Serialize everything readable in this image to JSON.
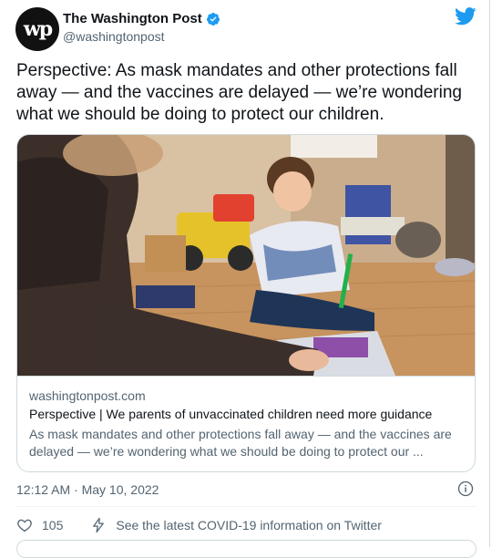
{
  "author": {
    "display_name": "The Washington Post",
    "handle": "@washingtonpost",
    "avatar_text": "wp"
  },
  "tweet": {
    "text": "Perspective: As mask mandates and other protections fall away — and the vaccines are delayed — we’re wondering what we should be doing to protect our children."
  },
  "card": {
    "domain": "washingtonpost.com",
    "title": "Perspective | We parents of unvaccinated children need more guidance",
    "description": "As mask mandates and other protections fall away — and the vaccines are delayed — we’re wondering what we should be doing to protect our ..."
  },
  "meta": {
    "timestamp": "12:12 AM · May 10, 2022"
  },
  "actions": {
    "like_count": "105",
    "covid_link": "See the latest COVID-19 information on Twitter"
  },
  "colors": {
    "twitter_blue": "#1d9bf0",
    "text_primary": "#0f1419",
    "text_secondary": "#536471",
    "border": "#cfd9de"
  },
  "icons": [
    "verified-badge-icon",
    "twitter-bird-icon",
    "info-icon",
    "heart-icon",
    "lightning-bolt-icon"
  ]
}
